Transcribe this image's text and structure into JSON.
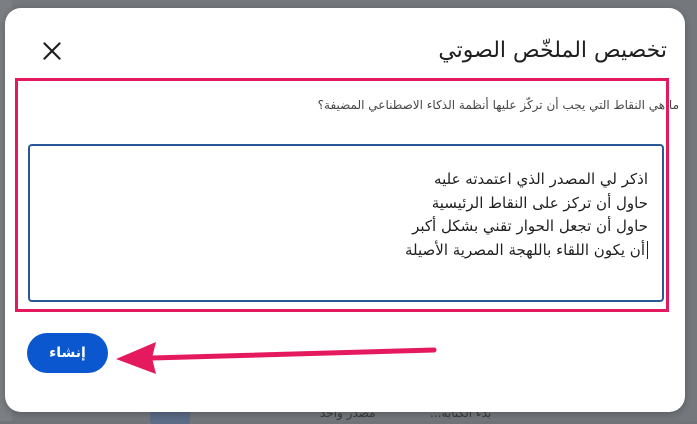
{
  "dialog": {
    "title": "تخصيص الملخّص الصوتي",
    "question": "ما هي النقاط التي يجب أن تركّز عليها أنظمة الذكاء الاصطناعي المضيفة؟",
    "prompt_lines": [
      "اذكر لي المصدر الذي اعتمدته عليه",
      "حاول أن تركز على النقاط الرئيسية",
      "حاول أن تجعل الحوار تقني بشكل أكبر",
      "أن يكون اللقاء باللهجة المصرية الأصيلة"
    ],
    "create_label": "إنشاء",
    "close_icon": "close-icon"
  },
  "background": {
    "row_text_1": "مصدر واحد",
    "row_text_2": "بدء الكتابة..."
  },
  "colors": {
    "highlight": "#e5195e",
    "primary": "#0b57d0",
    "textarea_border": "#2b579a"
  }
}
